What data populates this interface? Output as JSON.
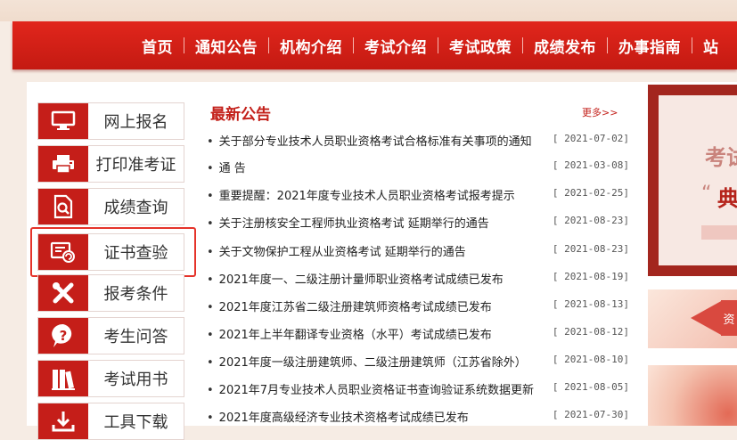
{
  "nav": {
    "items": [
      "首页",
      "通知公告",
      "机构介绍",
      "考试介绍",
      "考试政策",
      "成绩发布",
      "办事指南",
      "站"
    ]
  },
  "sidebar": {
    "items": [
      {
        "label": "网上报名",
        "icon": "monitor-icon"
      },
      {
        "label": "打印准考证",
        "icon": "printer-icon"
      },
      {
        "label": "成绩查询",
        "icon": "document-search-icon"
      },
      {
        "label": "证书查验",
        "icon": "certificate-verify-icon",
        "highlighted": true
      },
      {
        "label": "报考条件",
        "icon": "tools-icon"
      },
      {
        "label": "考生问答",
        "icon": "question-icon"
      },
      {
        "label": "考试用书",
        "icon": "books-icon"
      },
      {
        "label": "工具下载",
        "icon": "download-icon"
      }
    ]
  },
  "news": {
    "title": "最新公告",
    "more_label": "更多>>",
    "items": [
      {
        "text": "关于部分专业技术人员职业资格考试合格标准有关事项的通知",
        "date": "[ 2021-07-02]"
      },
      {
        "text": "通  告",
        "date": "[ 2021-03-08]"
      },
      {
        "text": "重要提醒：2021年度专业技术人员职业资格考试报考提示",
        "date": "[ 2021-02-25]"
      },
      {
        "text": "关于注册核安全工程师执业资格考试 延期举行的通告",
        "date": "[ 2021-08-23]"
      },
      {
        "text": "关于文物保护工程从业资格考试 延期举行的通告",
        "date": "[ 2021-08-23]"
      },
      {
        "text": "2021年度一、二级注册计量师职业资格考试成绩已发布",
        "date": "[ 2021-08-19]"
      },
      {
        "text": "2021年度江苏省二级注册建筑师资格考试成绩已发布",
        "date": "[ 2021-08-13]"
      },
      {
        "text": "2021年上半年翻译专业资格（水平）考试成绩已发布",
        "date": "[ 2021-08-12]"
      },
      {
        "text": "2021年度一级注册建筑师、二级注册建筑师（江苏省除外）",
        "date": "[ 2021-08-10]"
      },
      {
        "text": "2021年7月专业技术人员职业资格证书查询验证系统数据更新",
        "date": "[ 2021-08-05]"
      },
      {
        "text": "2021年度高级经济专业技术资格考试成绩已发布",
        "date": "[ 2021-07-30]"
      }
    ]
  },
  "banner1": {
    "text1": "考试",
    "text2": "典",
    "quote": "“"
  },
  "banner2": {
    "text": "资"
  },
  "colors": {
    "brand_red": "#c51e19",
    "nav_red": "#d8201a",
    "highlight": "#e5332a"
  }
}
